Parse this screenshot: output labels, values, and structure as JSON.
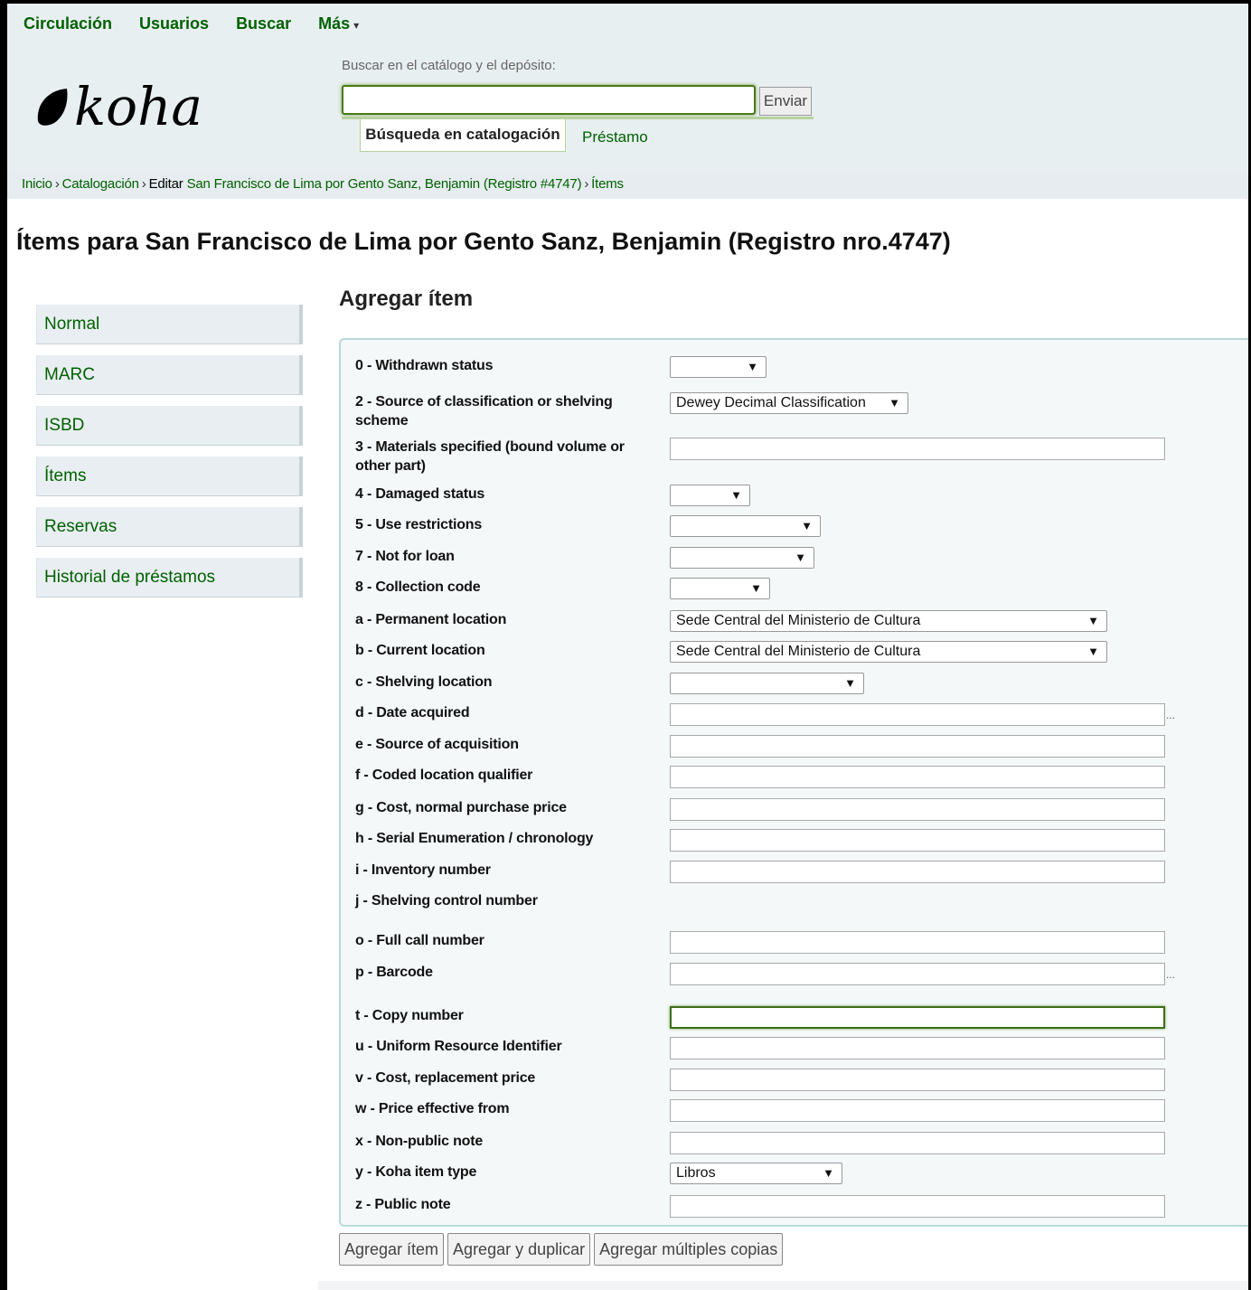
{
  "topnav": {
    "circulacion": "Circulación",
    "usuarios": "Usuarios",
    "buscar": "Buscar",
    "mas": "Más",
    "caret": "▾"
  },
  "logo": {
    "text": "koha"
  },
  "search": {
    "label": "Buscar en el catálogo y el depósito:",
    "value": "",
    "submit": "Enviar",
    "tab_active": "Búsqueda en catalogación",
    "tab_inactive": "Préstamo"
  },
  "breadcrumb": {
    "inicio": "Inicio",
    "catalogacion": "Catalogación",
    "sep": "›",
    "editar": "Editar",
    "record_link": "San Francisco de Lima por Gento Sanz, Benjamin (Registro #4747)",
    "items": "Ítems"
  },
  "page_title": "Ítems para San Francisco de Lima por Gento Sanz, Benjamin (Registro nro.4747)",
  "menu": [
    "Normal",
    "MARC",
    "ISBD",
    "Ítems",
    "Reservas",
    "Historial de préstamos"
  ],
  "section_title": "Agregar ítem",
  "fields": {
    "f0": {
      "label": "0 - Withdrawn status",
      "value": ""
    },
    "f2": {
      "label": "2 - Source of classification or shelving scheme",
      "value": "Dewey Decimal Classification"
    },
    "f3": {
      "label": "3 - Materials specified (bound volume or other part)",
      "value": ""
    },
    "f4": {
      "label": "4 - Damaged status",
      "value": ""
    },
    "f5": {
      "label": "5 - Use restrictions",
      "value": ""
    },
    "f7": {
      "label": "7 - Not for loan",
      "value": ""
    },
    "f8": {
      "label": "8 - Collection code",
      "value": ""
    },
    "fa": {
      "label": "a - Permanent location",
      "value": "Sede Central del Ministerio de Cultura"
    },
    "fb": {
      "label": "b - Current location",
      "value": "Sede Central del Ministerio de Cultura"
    },
    "fc": {
      "label": "c - Shelving location",
      "value": ""
    },
    "fd": {
      "label": "d - Date acquired",
      "value": ""
    },
    "fe": {
      "label": "e - Source of acquisition",
      "value": ""
    },
    "ff": {
      "label": "f - Coded location qualifier",
      "value": ""
    },
    "fg": {
      "label": "g - Cost, normal purchase price",
      "value": ""
    },
    "fh": {
      "label": "h - Serial Enumeration / chronology",
      "value": ""
    },
    "fi": {
      "label": "i - Inventory number",
      "value": ""
    },
    "fj": {
      "label": "j - Shelving control number"
    },
    "fo": {
      "label": "o - Full call number",
      "value": ""
    },
    "fp": {
      "label": "p - Barcode",
      "value": ""
    },
    "ft": {
      "label": "t - Copy number",
      "value": ""
    },
    "fu": {
      "label": "u - Uniform Resource Identifier",
      "value": ""
    },
    "fv": {
      "label": "v - Cost, replacement price",
      "value": ""
    },
    "fw": {
      "label": "w - Price effective from",
      "value": ""
    },
    "fx": {
      "label": "x - Non-public note",
      "value": ""
    },
    "fy": {
      "label": "y - Koha item type",
      "value": "Libros"
    },
    "fz": {
      "label": "z - Public note",
      "value": ""
    }
  },
  "plugin_dots": "...",
  "select_arrow": "▼",
  "buttons": {
    "add": "Agregar ítem",
    "add_duplicate": "Agregar y duplicar",
    "add_multiple": "Agregar múltiples copias"
  }
}
